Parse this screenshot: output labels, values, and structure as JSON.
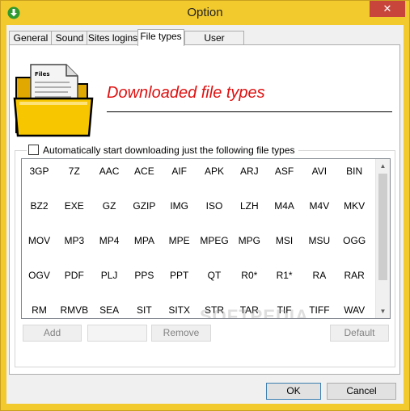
{
  "window": {
    "title": "Option",
    "close_glyph": "✕"
  },
  "tabs": [
    {
      "label": "General"
    },
    {
      "label": "Sound"
    },
    {
      "label": "Sites logins"
    },
    {
      "label": "File types"
    },
    {
      "label": "User interface"
    }
  ],
  "header": {
    "title": "Downloaded file types",
    "icon_label": "Files"
  },
  "group": {
    "checkbox_label": "Automatically start downloading just the following file types",
    "checked": false
  },
  "file_types": [
    "3GP",
    "7Z",
    "AAC",
    "ACE",
    "AIF",
    "APK",
    "ARJ",
    "ASF",
    "AVI",
    "BIN",
    "BZ2",
    "EXE",
    "GZ",
    "GZIP",
    "IMG",
    "ISO",
    "LZH",
    "M4A",
    "M4V",
    "MKV",
    "MOV",
    "MP3",
    "MP4",
    "MPA",
    "MPE",
    "MPEG",
    "MPG",
    "MSI",
    "MSU",
    "OGG",
    "OGV",
    "PDF",
    "PLJ",
    "PPS",
    "PPT",
    "QT",
    "R0*",
    "R1*",
    "RA",
    "RAR",
    "RM",
    "RMVB",
    "SEA",
    "SIT",
    "SITX",
    "STR",
    "TAR",
    "TIF",
    "TIFF",
    "WAV"
  ],
  "buttons": {
    "add": "Add",
    "remove": "Remove",
    "default": "Default",
    "ok": "OK",
    "cancel": "Cancel"
  },
  "watermark": "SOFTPEDIA",
  "colors": {
    "frame": "#f3ca2d",
    "close": "#c7453a",
    "header_text": "#e01010"
  }
}
